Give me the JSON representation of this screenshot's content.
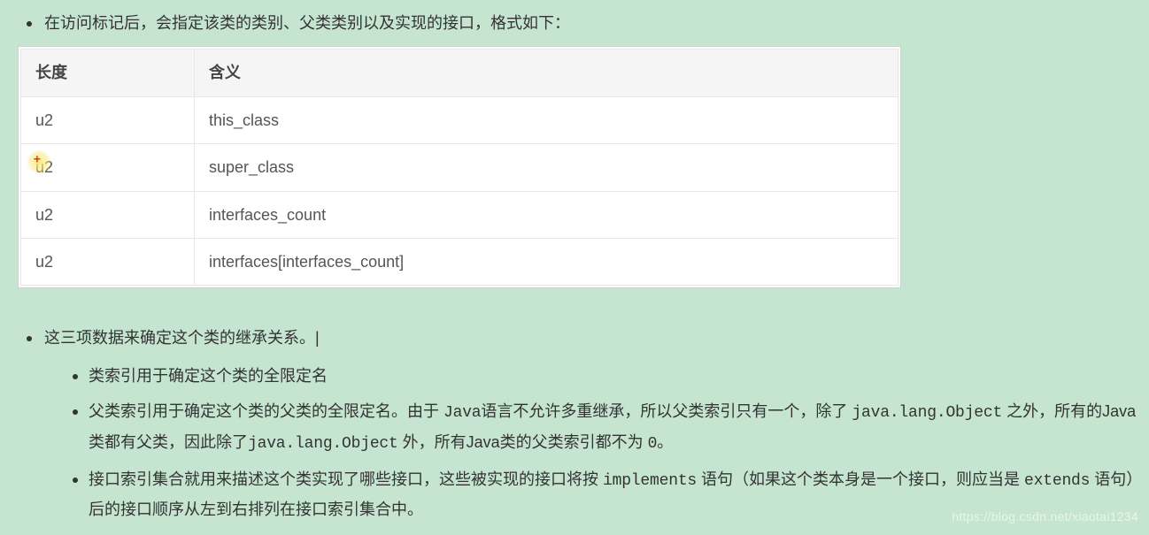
{
  "intro": {
    "bullet1": "在访问标记后，会指定该类的类别、父类类别以及实现的接口，格式如下："
  },
  "table": {
    "headers": {
      "col1": "长度",
      "col2": "含义"
    },
    "rows": [
      {
        "len": "u2",
        "meaning": "this_class",
        "highlight": false
      },
      {
        "len": "u2",
        "meaning": "super_class",
        "highlight": true
      },
      {
        "len": "u2",
        "meaning": "interfaces_count",
        "highlight": false
      },
      {
        "len": "u2",
        "meaning": "interfaces[interfaces_count]",
        "highlight": false
      }
    ]
  },
  "details": {
    "bullet2": "这三项数据来确定这个类的继承关系。",
    "sub": {
      "item1": "类索引用于确定这个类的全限定名",
      "item2": {
        "p1": "父类索引用于确定这个类的父类的全限定名。由于 ",
        "c1": "Java",
        "p2": "语言不允许多重继承，所以父类索引只有一个，除了 ",
        "c2": "java.lang.Object",
        "p3": " 之外，所有的Java类都有父类，因此除了",
        "c3": "java.lang.Object",
        "p4": " 外，所有Java类的父类索引都不为 ",
        "c4": "0",
        "p5": "。"
      },
      "item3": {
        "p1": "接口索引集合就用来描述这个类实现了哪些接口，这些被实现的接口将按 ",
        "c1": "implements",
        "p2": " 语句（如果这个类本身是一个接口，则应当是 ",
        "c2": "extends",
        "p3": " 语句）后的接口顺序从左到右排列在接口索引集合中。"
      }
    }
  },
  "watermark": "https://blog.csdn.net/xiaotai1234"
}
